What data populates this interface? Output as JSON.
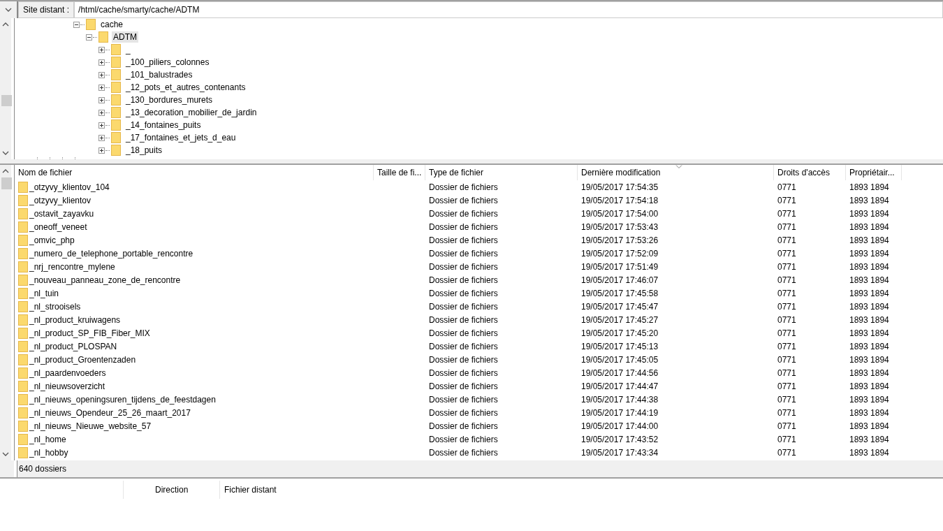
{
  "remote_site": {
    "label": "Site distant :",
    "path": "/html/cache/smarty/cache/ADTM"
  },
  "tree": [
    {
      "label": "cache",
      "expanded": true,
      "selected": false,
      "children": [
        {
          "label": "ADTM",
          "expanded": true,
          "selected": true,
          "children": [
            {
              "label": "_",
              "expanded": false,
              "selected": false
            },
            {
              "label": "_100_piliers_colonnes",
              "expanded": false,
              "selected": false
            },
            {
              "label": "_101_balustrades",
              "expanded": false,
              "selected": false
            },
            {
              "label": "_12_pots_et_autres_contenants",
              "expanded": false,
              "selected": false
            },
            {
              "label": "_130_bordures_murets",
              "expanded": false,
              "selected": false
            },
            {
              "label": "_13_decoration_mobilier_de_jardin",
              "expanded": false,
              "selected": false
            },
            {
              "label": "_14_fontaines_puits",
              "expanded": false,
              "selected": false
            },
            {
              "label": "_17_fontaines_et_jets_d_eau",
              "expanded": false,
              "selected": false
            },
            {
              "label": "_18_puits",
              "expanded": false,
              "selected": false
            }
          ]
        }
      ]
    }
  ],
  "file_list": {
    "columns": [
      {
        "label": "Nom de fichier",
        "sorted": false
      },
      {
        "label": "Taille de fi...",
        "sorted": false
      },
      {
        "label": "Type de fichier",
        "sorted": false
      },
      {
        "label": "Dernière modification",
        "sorted": true
      },
      {
        "label": "Droits d'accès",
        "sorted": false
      },
      {
        "label": "Propriétair...",
        "sorted": false
      }
    ],
    "rows": [
      {
        "name": "_otzyvy_klientov_104",
        "type": "Dossier de fichiers",
        "modified": "19/05/2017 17:54:35",
        "rights": "0771",
        "owner": "1893 1894"
      },
      {
        "name": "_otzyvy_klientov",
        "type": "Dossier de fichiers",
        "modified": "19/05/2017 17:54:18",
        "rights": "0771",
        "owner": "1893 1894"
      },
      {
        "name": "_ostavit_zayavku",
        "type": "Dossier de fichiers",
        "modified": "19/05/2017 17:54:00",
        "rights": "0771",
        "owner": "1893 1894"
      },
      {
        "name": "_oneoff_veneet",
        "type": "Dossier de fichiers",
        "modified": "19/05/2017 17:53:43",
        "rights": "0771",
        "owner": "1893 1894"
      },
      {
        "name": "_omvic_php",
        "type": "Dossier de fichiers",
        "modified": "19/05/2017 17:53:26",
        "rights": "0771",
        "owner": "1893 1894"
      },
      {
        "name": "_numero_de_telephone_portable_rencontre",
        "type": "Dossier de fichiers",
        "modified": "19/05/2017 17:52:09",
        "rights": "0771",
        "owner": "1893 1894"
      },
      {
        "name": "_nrj_rencontre_mylene",
        "type": "Dossier de fichiers",
        "modified": "19/05/2017 17:51:49",
        "rights": "0771",
        "owner": "1893 1894"
      },
      {
        "name": "_nouveau_panneau_zone_de_rencontre",
        "type": "Dossier de fichiers",
        "modified": "19/05/2017 17:46:07",
        "rights": "0771",
        "owner": "1893 1894"
      },
      {
        "name": "_nl_tuin",
        "type": "Dossier de fichiers",
        "modified": "19/05/2017 17:45:58",
        "rights": "0771",
        "owner": "1893 1894"
      },
      {
        "name": "_nl_strooisels",
        "type": "Dossier de fichiers",
        "modified": "19/05/2017 17:45:47",
        "rights": "0771",
        "owner": "1893 1894"
      },
      {
        "name": "_nl_product_kruiwagens",
        "type": "Dossier de fichiers",
        "modified": "19/05/2017 17:45:27",
        "rights": "0771",
        "owner": "1893 1894"
      },
      {
        "name": "_nl_product_SP_FIB_Fiber_MIX",
        "type": "Dossier de fichiers",
        "modified": "19/05/2017 17:45:20",
        "rights": "0771",
        "owner": "1893 1894"
      },
      {
        "name": "_nl_product_PLOSPAN",
        "type": "Dossier de fichiers",
        "modified": "19/05/2017 17:45:13",
        "rights": "0771",
        "owner": "1893 1894"
      },
      {
        "name": "_nl_product_Groentenzaden",
        "type": "Dossier de fichiers",
        "modified": "19/05/2017 17:45:05",
        "rights": "0771",
        "owner": "1893 1894"
      },
      {
        "name": "_nl_paardenvoeders",
        "type": "Dossier de fichiers",
        "modified": "19/05/2017 17:44:56",
        "rights": "0771",
        "owner": "1893 1894"
      },
      {
        "name": "_nl_nieuwsoverzicht",
        "type": "Dossier de fichiers",
        "modified": "19/05/2017 17:44:47",
        "rights": "0771",
        "owner": "1893 1894"
      },
      {
        "name": "_nl_nieuws_openingsuren_tijdens_de_feestdagen",
        "type": "Dossier de fichiers",
        "modified": "19/05/2017 17:44:38",
        "rights": "0771",
        "owner": "1893 1894"
      },
      {
        "name": "_nl_nieuws_Opendeur_25_26_maart_2017",
        "type": "Dossier de fichiers",
        "modified": "19/05/2017 17:44:19",
        "rights": "0771",
        "owner": "1893 1894"
      },
      {
        "name": "_nl_nieuws_Nieuwe_website_57",
        "type": "Dossier de fichiers",
        "modified": "19/05/2017 17:44:00",
        "rights": "0771",
        "owner": "1893 1894"
      },
      {
        "name": "_nl_home",
        "type": "Dossier de fichiers",
        "modified": "19/05/2017 17:43:52",
        "rights": "0771",
        "owner": "1893 1894"
      },
      {
        "name": "_nl_hobby",
        "type": "Dossier de fichiers",
        "modified": "19/05/2017 17:43:34",
        "rights": "0771",
        "owner": "1893 1894"
      }
    ]
  },
  "status_bar": "640 dossiers",
  "queue": {
    "columns": [
      "Direction",
      "Fichier distant"
    ]
  }
}
